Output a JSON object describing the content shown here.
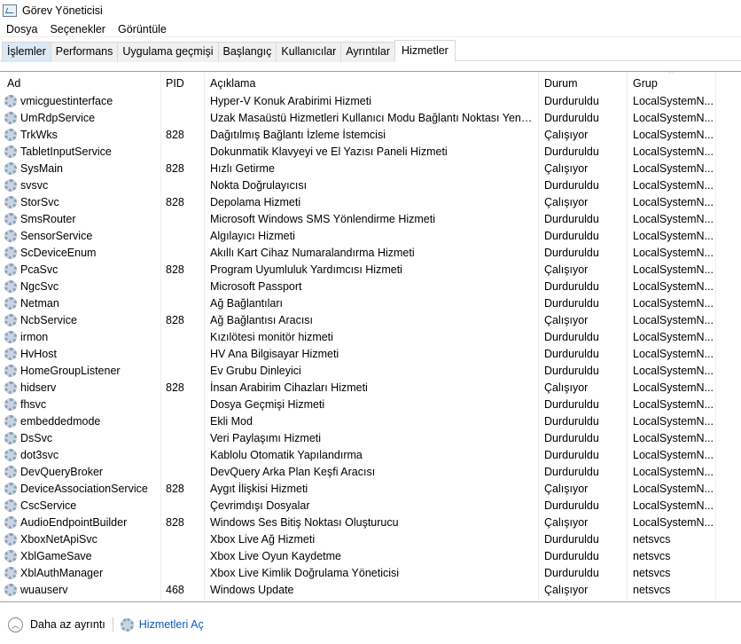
{
  "window": {
    "title": "Görev Yöneticisi"
  },
  "menu": [
    "Dosya",
    "Seçenekler",
    "Görüntüle"
  ],
  "tabs": [
    "İşlemler",
    "Performans",
    "Uygulama geçmişi",
    "Başlangıç",
    "Kullanıcılar",
    "Ayrıntılar",
    "Hizmetler"
  ],
  "active_tab": "Hizmetler",
  "columns": {
    "name": "Ad",
    "pid": "PID",
    "desc": "Açıklama",
    "status": "Durum",
    "group": "Grup"
  },
  "rows": [
    [
      "vmicguestinterface",
      "",
      "Hyper-V Konuk Arabirimi Hizmeti",
      "Durduruldu",
      "LocalSystemN..."
    ],
    [
      "UmRdpService",
      "",
      "Uzak Masaüstü Hizmetleri Kullanıcı Modu Bağlantı Noktası Yeniden...",
      "Durduruldu",
      "LocalSystemN..."
    ],
    [
      "TrkWks",
      "828",
      "Dağıtılmış Bağlantı İzleme İstemcisi",
      "Çalışıyor",
      "LocalSystemN..."
    ],
    [
      "TabletInputService",
      "",
      "Dokunmatik Klavyeyi ve El Yazısı Paneli Hizmeti",
      "Durduruldu",
      "LocalSystemN..."
    ],
    [
      "SysMain",
      "828",
      "Hızlı Getirme",
      "Çalışıyor",
      "LocalSystemN..."
    ],
    [
      "svsvc",
      "",
      "Nokta Doğrulayıcısı",
      "Durduruldu",
      "LocalSystemN..."
    ],
    [
      "StorSvc",
      "828",
      "Depolama Hizmeti",
      "Çalışıyor",
      "LocalSystemN..."
    ],
    [
      "SmsRouter",
      "",
      "Microsoft Windows SMS Yönlendirme Hizmeti",
      "Durduruldu",
      "LocalSystemN..."
    ],
    [
      "SensorService",
      "",
      "Algılayıcı Hizmeti",
      "Durduruldu",
      "LocalSystemN..."
    ],
    [
      "ScDeviceEnum",
      "",
      "Akıllı Kart Cihaz Numaralandırma Hizmeti",
      "Durduruldu",
      "LocalSystemN..."
    ],
    [
      "PcaSvc",
      "828",
      "Program Uyumluluk Yardımcısı Hizmeti",
      "Çalışıyor",
      "LocalSystemN..."
    ],
    [
      "NgcSvc",
      "",
      "Microsoft Passport",
      "Durduruldu",
      "LocalSystemN..."
    ],
    [
      "Netman",
      "",
      "Ağ Bağlantıları",
      "Durduruldu",
      "LocalSystemN..."
    ],
    [
      "NcbService",
      "828",
      "Ağ Bağlantısı Aracısı",
      "Çalışıyor",
      "LocalSystemN..."
    ],
    [
      "irmon",
      "",
      "Kızılötesi monitör hizmeti",
      "Durduruldu",
      "LocalSystemN..."
    ],
    [
      "HvHost",
      "",
      "HV Ana Bilgisayar Hizmeti",
      "Durduruldu",
      "LocalSystemN..."
    ],
    [
      "HomeGroupListener",
      "",
      "Ev Grubu Dinleyici",
      "Durduruldu",
      "LocalSystemN..."
    ],
    [
      "hidserv",
      "828",
      "İnsan Arabirim Cihazları Hizmeti",
      "Çalışıyor",
      "LocalSystemN..."
    ],
    [
      "fhsvc",
      "",
      "Dosya Geçmişi Hizmeti",
      "Durduruldu",
      "LocalSystemN..."
    ],
    [
      "embeddedmode",
      "",
      "Ekli Mod",
      "Durduruldu",
      "LocalSystemN..."
    ],
    [
      "DsSvc",
      "",
      "Veri Paylaşımı Hizmeti",
      "Durduruldu",
      "LocalSystemN..."
    ],
    [
      "dot3svc",
      "",
      "Kablolu Otomatik Yapılandırma",
      "Durduruldu",
      "LocalSystemN..."
    ],
    [
      "DevQueryBroker",
      "",
      "DevQuery Arka Plan Keşfi Aracısı",
      "Durduruldu",
      "LocalSystemN..."
    ],
    [
      "DeviceAssociationService",
      "828",
      "Aygıt İlişkisi Hizmeti",
      "Çalışıyor",
      "LocalSystemN..."
    ],
    [
      "CscService",
      "",
      "Çevrimdışı Dosyalar",
      "Durduruldu",
      "LocalSystemN..."
    ],
    [
      "AudioEndpointBuilder",
      "828",
      "Windows Ses Bitiş Noktası Oluşturucu",
      "Çalışıyor",
      "LocalSystemN..."
    ],
    [
      "XboxNetApiSvc",
      "",
      "Xbox Live Ağ Hizmeti",
      "Durduruldu",
      "netsvcs"
    ],
    [
      "XblGameSave",
      "",
      "Xbox Live Oyun Kaydetme",
      "Durduruldu",
      "netsvcs"
    ],
    [
      "XblAuthManager",
      "",
      "Xbox Live Kimlik Doğrulama Yöneticisi",
      "Durduruldu",
      "netsvcs"
    ],
    [
      "wuauserv",
      "468",
      "Windows Update",
      "Çalışıyor",
      "netsvcs"
    ]
  ],
  "footer": {
    "less_details": "Daha az ayrıntı",
    "open_services": "Hizmetleri Aç"
  }
}
